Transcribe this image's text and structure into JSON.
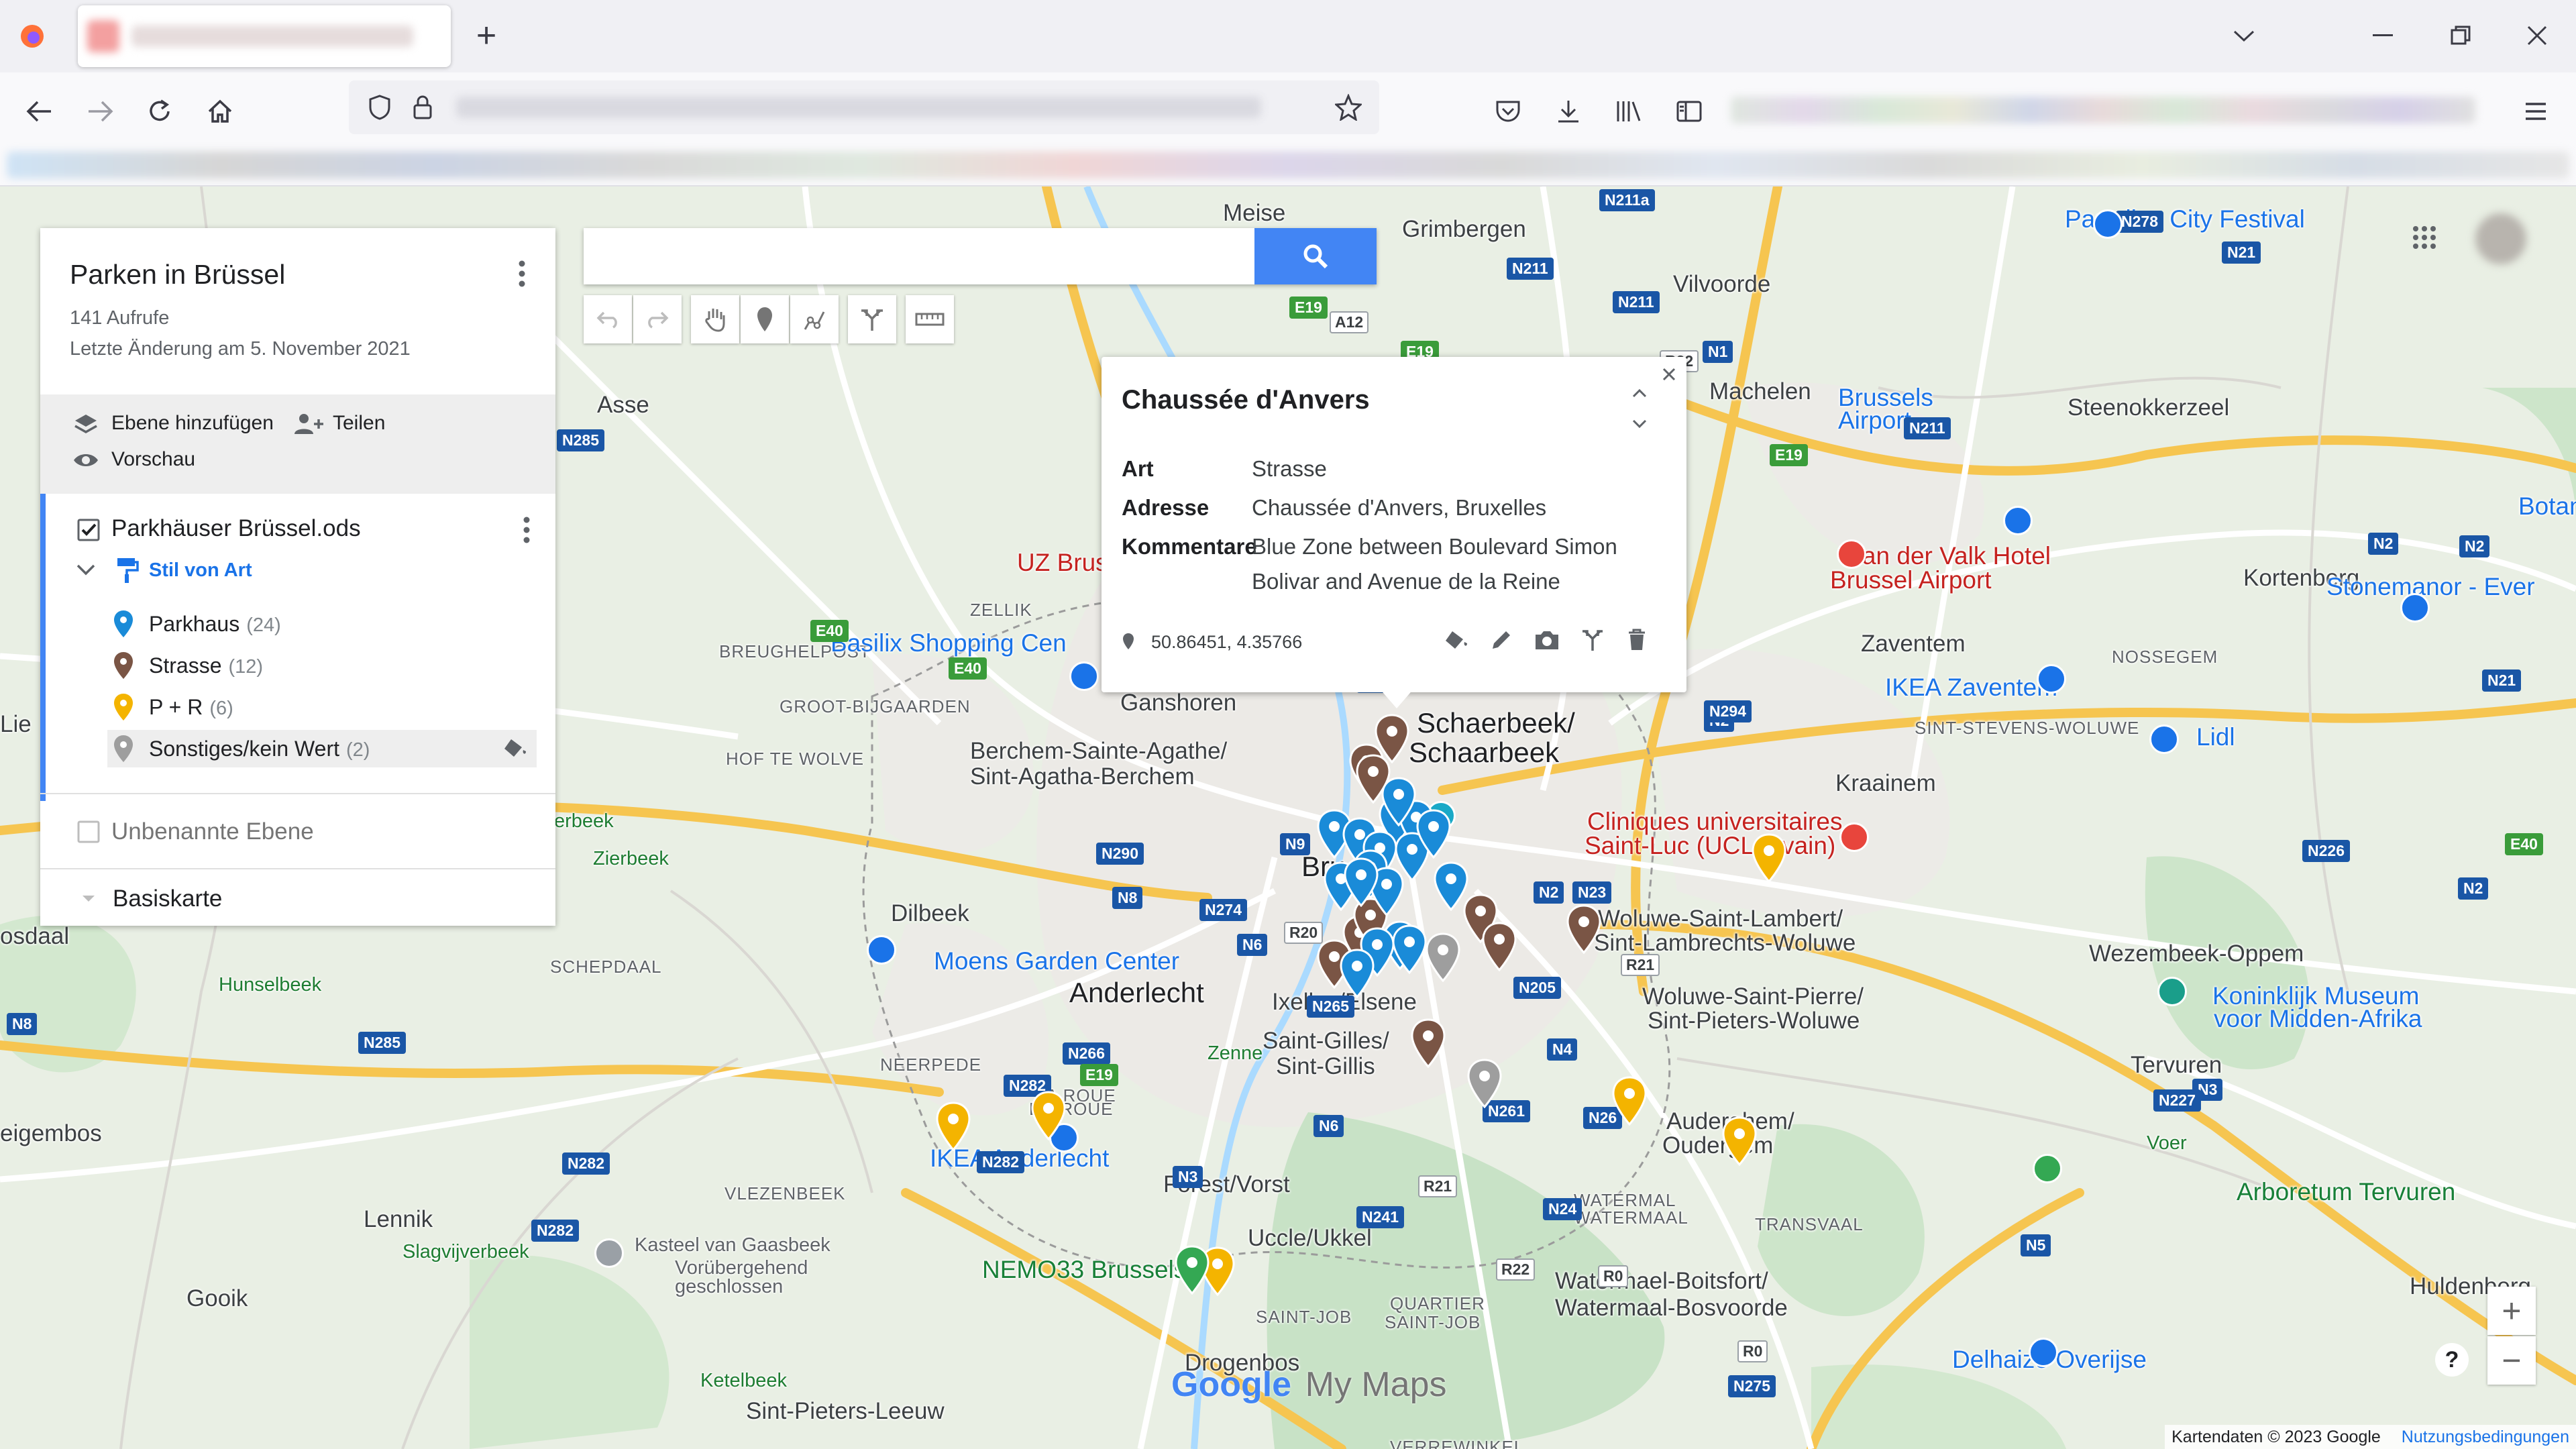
{
  "browser": {
    "new_tab_symbol": "+",
    "window_controls": [
      "minimize-icon",
      "restore-icon",
      "close-icon"
    ]
  },
  "map": {
    "places": [
      {
        "text": "Meise",
        "cls": ""
      },
      {
        "text": "Grimbergen",
        "cls": ""
      },
      {
        "text": "Vilvoorde",
        "cls": ""
      },
      {
        "text": "Machelen",
        "cls": ""
      },
      {
        "text": "Steenokkerzeel",
        "cls": ""
      },
      {
        "text": "Asse",
        "cls": ""
      },
      {
        "text": "Kortenberg",
        "cls": ""
      },
      {
        "text": "Zaventem",
        "cls": ""
      },
      {
        "text": "Kraainem",
        "cls": ""
      },
      {
        "text": "Ganshoren",
        "cls": ""
      },
      {
        "text": "Berchem-Sainte-Agathe/",
        "cls": ""
      },
      {
        "text": "Sint-Agatha-Berchem",
        "cls": ""
      },
      {
        "text": "Schaerbeek/",
        "cls": "big"
      },
      {
        "text": "Schaarbeek",
        "cls": "big"
      },
      {
        "text": "Dilbeek",
        "cls": ""
      },
      {
        "text": "Anderlecht",
        "cls": "big"
      },
      {
        "text": "Ixelles/Elsene",
        "cls": ""
      },
      {
        "text": "Saint-Gilles/",
        "cls": ""
      },
      {
        "text": "Sint-Gillis",
        "cls": ""
      },
      {
        "text": "Woluwe-Saint-Lambert/",
        "cls": ""
      },
      {
        "text": "Sint-Lambrechts-Woluwe",
        "cls": ""
      },
      {
        "text": "Woluwe-Saint-Pierre/",
        "cls": ""
      },
      {
        "text": "Sint-Pieters-Woluwe",
        "cls": ""
      },
      {
        "text": "Wezembeek-Oppem",
        "cls": ""
      },
      {
        "text": "Tervuren",
        "cls": ""
      },
      {
        "text": "Forest/Vorst",
        "cls": ""
      },
      {
        "text": "Uccle/Ukkel",
        "cls": ""
      },
      {
        "text": "Auderghem/",
        "cls": ""
      },
      {
        "text": "Oudergem",
        "cls": ""
      },
      {
        "text": "Watermael-Boitsfort/",
        "cls": ""
      },
      {
        "text": "Watermaal-Bosvoorde",
        "cls": ""
      },
      {
        "text": "Lennik",
        "cls": ""
      },
      {
        "text": "Gooik",
        "cls": ""
      },
      {
        "text": "Drogenbos",
        "cls": ""
      },
      {
        "text": "Sint-Pieters-Leeuw",
        "cls": ""
      },
      {
        "text": "Huldenberg",
        "cls": ""
      },
      {
        "text": "Lie",
        "cls": ""
      },
      {
        "text": "eigembos",
        "cls": ""
      },
      {
        "text": "osdaal",
        "cls": ""
      },
      {
        "text": "Bru",
        "cls": "big"
      },
      {
        "text": "ZELLIK",
        "cls": "small"
      },
      {
        "text": "BREUGHELPOST",
        "cls": "small"
      },
      {
        "text": "GROOT-BIJGAARDEN",
        "cls": "small"
      },
      {
        "text": "HOF TE WOLVE",
        "cls": "small"
      },
      {
        "text": "SCHEPDAAL",
        "cls": "small"
      },
      {
        "text": "NEERPEDE",
        "cls": "small"
      },
      {
        "text": "LA ROUE",
        "cls": "small"
      },
      {
        "text": "DE ROUE",
        "cls": "small"
      },
      {
        "text": "VLEZENBEEK",
        "cls": "small"
      },
      {
        "text": "SAINT-JOB",
        "cls": "small"
      },
      {
        "text": "QUARTIER",
        "cls": "small"
      },
      {
        "text": "SAINT-JOB",
        "cls": "small"
      },
      {
        "text": "WATERMAL",
        "cls": "small"
      },
      {
        "text": "WATERMAAL",
        "cls": "small"
      },
      {
        "text": "TRANSVAAL",
        "cls": "small"
      },
      {
        "text": "NOSSEGEM",
        "cls": "small"
      },
      {
        "text": "SINT-STEVENS-WOLUWE",
        "cls": "small"
      },
      {
        "text": "VERREWINKEL",
        "cls": "small"
      },
      {
        "text": "Hunselbeek",
        "cls": "green"
      },
      {
        "text": "Zierbeek",
        "cls": "green"
      },
      {
        "text": "Slagvijverbeek",
        "cls": "green"
      },
      {
        "text": "Ketelbeek",
        "cls": "green"
      },
      {
        "text": "Zenne",
        "cls": "green"
      },
      {
        "text": "erbeek",
        "cls": "green"
      },
      {
        "text": "Voer",
        "cls": "green"
      },
      {
        "text": "UZ Brus",
        "cls": "poi-red"
      },
      {
        "text": "Van der Valk Hotel",
        "cls": "poi-red"
      },
      {
        "text": "Brussel Airport",
        "cls": "poi-red"
      },
      {
        "text": "Cliniques universitaires",
        "cls": "poi-red"
      },
      {
        "text": "Saint-Luc (UCLouvain)",
        "cls": "poi-red"
      },
      {
        "text": "Basilix Shopping Cen",
        "cls": "poi-blue"
      },
      {
        "text": "Moens Garden Center",
        "cls": "poi-blue"
      },
      {
        "text": "IKEA Anderlecht",
        "cls": "poi-blue"
      },
      {
        "text": "IKEA Zaventem",
        "cls": "poi-blue"
      },
      {
        "text": "Brussels",
        "cls": "poi-blue"
      },
      {
        "text": "Airport",
        "cls": "poi-blue"
      },
      {
        "text": "Stonemanor - Ever",
        "cls": "poi-blue"
      },
      {
        "text": "Botanic",
        "cls": "poi-blue"
      },
      {
        "text": "Lidl",
        "cls": "poi-blue"
      },
      {
        "text": "Paradise City Festival",
        "cls": "poi-blue"
      },
      {
        "text": "Koninklijk Museum",
        "cls": "poi-blue"
      },
      {
        "text": "voor Midden-Afrika",
        "cls": "poi-blue"
      },
      {
        "text": "Delhaize Overijse",
        "cls": "poi-blue"
      },
      {
        "text": "NEMO33 Brussels",
        "cls": "poi-green"
      },
      {
        "text": "Arboretum Tervuren",
        "cls": "poi-green"
      },
      {
        "text": "Kasteel van Gaasbeek",
        "cls": "poi-grey"
      },
      {
        "text": "Vorübergehend",
        "cls": "poi-grey"
      },
      {
        "text": "geschlossen",
        "cls": "poi-grey"
      }
    ],
    "roads": [
      "N211a",
      "N278",
      "N211",
      "N21",
      "N211",
      "R22",
      "N1",
      "E19",
      "N211",
      "E19",
      "A12",
      "E19",
      "N285",
      "N2",
      "N2",
      "N2",
      "E40",
      "E40",
      "N294",
      "N8",
      "N9",
      "N290",
      "N8",
      "N274",
      "N6",
      "R20",
      "N265",
      "N2",
      "N23",
      "R21",
      "N205",
      "N226",
      "E40",
      "N3",
      "N4",
      "N285",
      "N266",
      "N282",
      "N282",
      "N282",
      "N282",
      "E19",
      "N6",
      "N241",
      "N261",
      "R21",
      "N24",
      "N5",
      "N227",
      "N3",
      "R22",
      "N275",
      "R0",
      "N8",
      "N2",
      "N21",
      "N26",
      "R0"
    ],
    "footer_copyright": "Kartendaten © 2023 Google",
    "footer_terms": "Nutzungsbedingungen",
    "logo_google": "Google",
    "logo_mymaps": "My Maps",
    "zoom_in": "+",
    "zoom_out": "−",
    "help": "?"
  },
  "panel": {
    "title": "Parken in Brüssel",
    "views": "141 Aufrufe",
    "last_change": "Letzte Änderung am 5. November 2021",
    "add_layer": "Ebene hinzufügen",
    "share": "Teilen",
    "preview": "Vorschau",
    "layer1": {
      "name": "Parkhäuser Brüssel.ods",
      "style": "Stil von Art",
      "categories": [
        {
          "label": "Parkhaus",
          "count": "(24)",
          "color": "#1a8bd8"
        },
        {
          "label": "Strasse",
          "count": "(12)",
          "color": "#7a5545"
        },
        {
          "label": "P + R",
          "count": "(6)",
          "color": "#f4b400"
        },
        {
          "label": "Sonstiges/kein Wert",
          "count": "(2)",
          "color": "#9e9e9e"
        }
      ]
    },
    "layer2": {
      "name": "Unbenannte Ebene"
    },
    "basemap": "Basiskarte"
  },
  "popup": {
    "title": "Chaussée d'Anvers",
    "rows": [
      {
        "label": "Art",
        "value": "Strasse"
      },
      {
        "label": "Adresse",
        "value": "Chaussée d'Anvers, Bruxelles"
      },
      {
        "label": "Kommentare",
        "value": "Blue Zone between Boulevard Simon"
      },
      {
        "label": "",
        "value": "Bolivar and Avenue de la Reine"
      }
    ],
    "coords": "50.86451, 4.35766"
  },
  "colors": {
    "parkhaus": "#1a8bd8",
    "strasse": "#7a5545",
    "pr": "#f4b400",
    "sonstiges": "#9e9e9e",
    "accent": "#4285f4"
  }
}
